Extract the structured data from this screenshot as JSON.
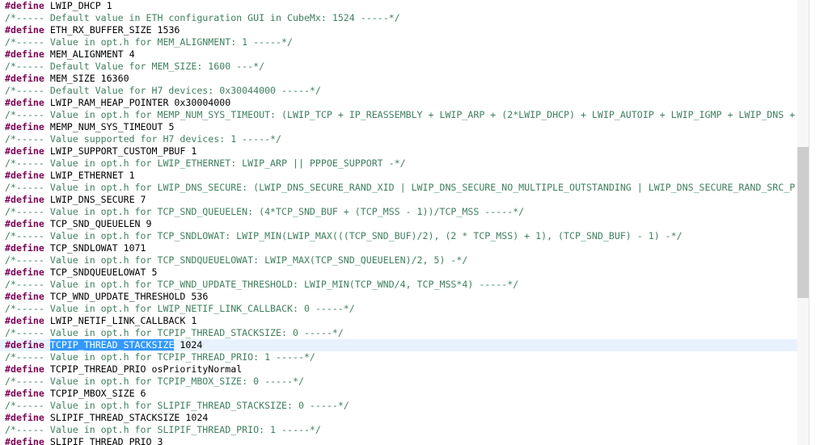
{
  "editor": {
    "directive": "#define",
    "selection_line": 28,
    "scrollbar": {
      "thumb_position_fraction": 0.33,
      "thumb_size_fraction": 0.34
    },
    "lines": [
      {
        "kind": "define",
        "rest": "LWIP_DHCP 1"
      },
      {
        "kind": "comment",
        "text": "/*----- Default value in ETH configuration GUI in CubeMx: 1524 -----*/"
      },
      {
        "kind": "define",
        "rest": "ETH_RX_BUFFER_SIZE 1536"
      },
      {
        "kind": "comment",
        "text": "/*----- Value in opt.h for MEM_ALIGNMENT: 1 -----*/"
      },
      {
        "kind": "define",
        "rest": "MEM_ALIGNMENT 4"
      },
      {
        "kind": "comment",
        "text": "/*----- Default Value for MEM_SIZE: 1600 ---*/"
      },
      {
        "kind": "define",
        "rest": "MEM_SIZE 16360"
      },
      {
        "kind": "comment",
        "text": "/*----- Default Value for H7 devices: 0x30044000 -----*/"
      },
      {
        "kind": "define",
        "rest": "LWIP_RAM_HEAP_POINTER 0x30004000"
      },
      {
        "kind": "comment",
        "text": "/*----- Value in opt.h for MEMP_NUM_SYS_TIMEOUT: (LWIP_TCP + IP_REASSEMBLY + LWIP_ARP + (2*LWIP_DHCP) + LWIP_AUTOIP + LWIP_IGMP + LWIP_DNS + "
      },
      {
        "kind": "define",
        "rest": "MEMP_NUM_SYS_TIMEOUT 5"
      },
      {
        "kind": "comment",
        "text": "/*----- Value supported for H7 devices: 1 -----*/"
      },
      {
        "kind": "define",
        "rest": "LWIP_SUPPORT_CUSTOM_PBUF 1"
      },
      {
        "kind": "comment",
        "text": "/*----- Value in opt.h for LWIP_ETHERNET: LWIP_ARP || PPPOE_SUPPORT -*/"
      },
      {
        "kind": "define",
        "rest": "LWIP_ETHERNET 1"
      },
      {
        "kind": "comment",
        "text": "/*----- Value in opt.h for LWIP_DNS_SECURE: (LWIP_DNS_SECURE_RAND_XID | LWIP_DNS_SECURE_NO_MULTIPLE_OUTSTANDING | LWIP_DNS_SECURE_RAND_SRC_P"
      },
      {
        "kind": "define",
        "rest": "LWIP_DNS_SECURE 7"
      },
      {
        "kind": "comment",
        "text": "/*----- Value in opt.h for TCP_SND_QUEUELEN: (4*TCP_SND_BUF + (TCP_MSS - 1))/TCP_MSS -----*/"
      },
      {
        "kind": "define",
        "rest": "TCP_SND_QUEUELEN 9"
      },
      {
        "kind": "comment",
        "text": "/*----- Value in opt.h for TCP_SNDLOWAT: LWIP_MIN(LWIP_MAX(((TCP_SND_BUF)/2), (2 * TCP_MSS) + 1), (TCP_SND_BUF) - 1) -*/"
      },
      {
        "kind": "define",
        "rest": "TCP_SNDLOWAT 1071"
      },
      {
        "kind": "comment",
        "text": "/*----- Value in opt.h for TCP_SNDQUEUELOWAT: LWIP_MAX(TCP_SND_QUEUELEN)/2, 5) -*/"
      },
      {
        "kind": "define",
        "rest": "TCP_SNDQUEUELOWAT 5"
      },
      {
        "kind": "comment",
        "text": "/*----- Value in opt.h for TCP_WND_UPDATE_THRESHOLD: LWIP_MIN(TCP_WND/4, TCP_MSS*4) -----*/"
      },
      {
        "kind": "define",
        "rest": "TCP_WND_UPDATE_THRESHOLD 536"
      },
      {
        "kind": "comment",
        "text": "/*----- Value in opt.h for LWIP_NETIF_LINK_CALLBACK: 0 -----*/"
      },
      {
        "kind": "define",
        "rest": "LWIP_NETIF_LINK_CALLBACK 1"
      },
      {
        "kind": "comment",
        "text": "/*----- Value in opt.h for TCPIP_THREAD_STACKSIZE: 0 -----*/"
      },
      {
        "kind": "define",
        "selected": "TCPIP_THREAD_STACKSIZE",
        "rest": " 1024"
      },
      {
        "kind": "comment",
        "text": "/*----- Value in opt.h for TCPIP_THREAD_PRIO: 1 -----*/"
      },
      {
        "kind": "define",
        "rest": "TCPIP_THREAD_PRIO osPriorityNormal"
      },
      {
        "kind": "comment",
        "text": "/*----- Value in opt.h for TCPIP_MBOX_SIZE: 0 -----*/"
      },
      {
        "kind": "define",
        "rest": "TCPIP_MBOX_SIZE 6"
      },
      {
        "kind": "comment",
        "text": "/*----- Value in opt.h for SLIPIF_THREAD_STACKSIZE: 0 -----*/"
      },
      {
        "kind": "define",
        "rest": "SLIPIF_THREAD_STACKSIZE 1024"
      },
      {
        "kind": "comment",
        "text": "/*----- Value in opt.h for SLIPIF_THREAD_PRIO: 1 -----*/"
      },
      {
        "kind": "define",
        "rest": "SLIPIF_THREAD_PRIO 3"
      }
    ]
  }
}
